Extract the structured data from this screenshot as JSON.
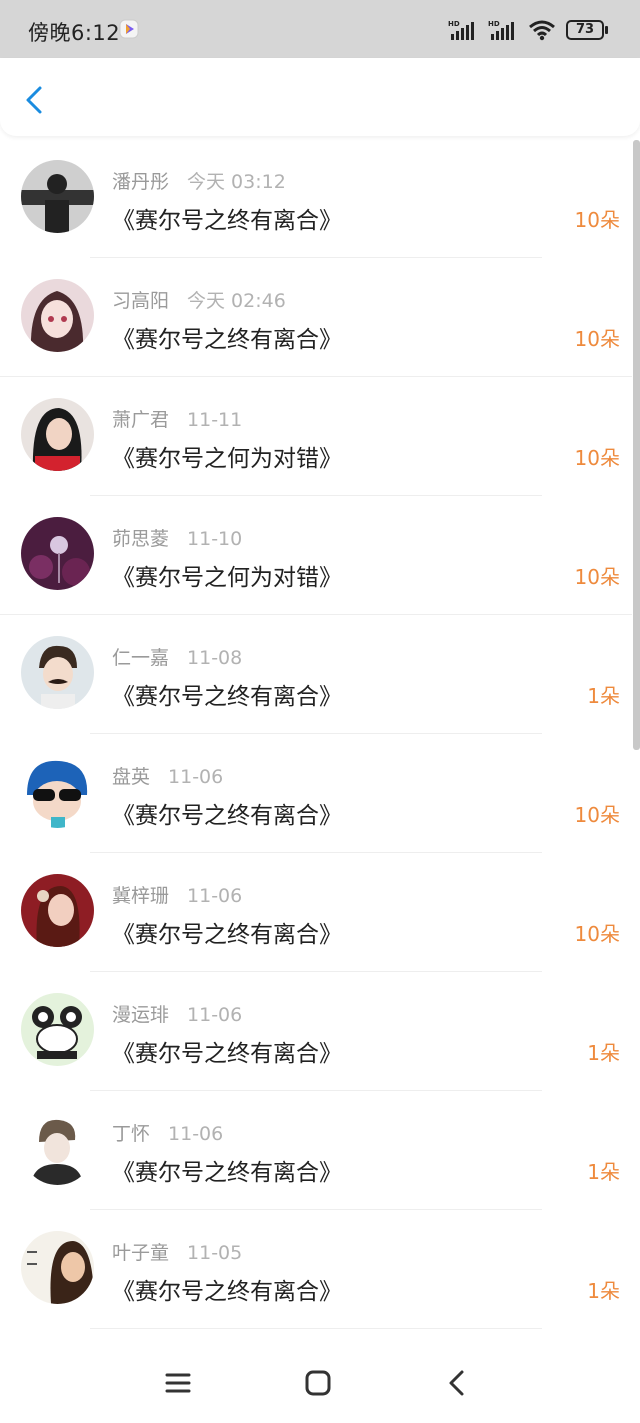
{
  "status": {
    "time": "傍晚6:12",
    "battery": "73"
  },
  "colors": {
    "accent": "#1a8ce0",
    "amount": "#ee8a3d"
  },
  "header": {
    "back_icon": "chevron-left-icon"
  },
  "records": [
    {
      "name": "潘丹彤",
      "time": "今天 03:12",
      "book": "《赛尔号之终有离合》",
      "amount": "10朵"
    },
    {
      "name": "习高阳",
      "time": "今天 02:46",
      "book": "《赛尔号之终有离合》",
      "amount": "10朵"
    },
    {
      "name": "萧广君",
      "time": "11-11",
      "book": "《赛尔号之何为对错》",
      "amount": "10朵"
    },
    {
      "name": "茆思菱",
      "time": "11-10",
      "book": "《赛尔号之何为对错》",
      "amount": "10朵"
    },
    {
      "name": "仁一嘉",
      "time": "11-08",
      "book": "《赛尔号之终有离合》",
      "amount": "1朵"
    },
    {
      "name": "盘英",
      "time": "11-06",
      "book": "《赛尔号之终有离合》",
      "amount": "10朵"
    },
    {
      "name": "冀梓珊",
      "time": "11-06",
      "book": "《赛尔号之终有离合》",
      "amount": "10朵"
    },
    {
      "name": "漫运琲",
      "time": "11-06",
      "book": "《赛尔号之终有离合》",
      "amount": "1朵"
    },
    {
      "name": "丁怀",
      "time": "11-06",
      "book": "《赛尔号之终有离合》",
      "amount": "1朵"
    },
    {
      "name": "叶子童",
      "time": "11-05",
      "book": "《赛尔号之终有离合》",
      "amount": "1朵"
    }
  ],
  "navbar": {
    "menu_icon": "menu-icon",
    "home_icon": "home-icon",
    "back_icon": "back-icon"
  }
}
